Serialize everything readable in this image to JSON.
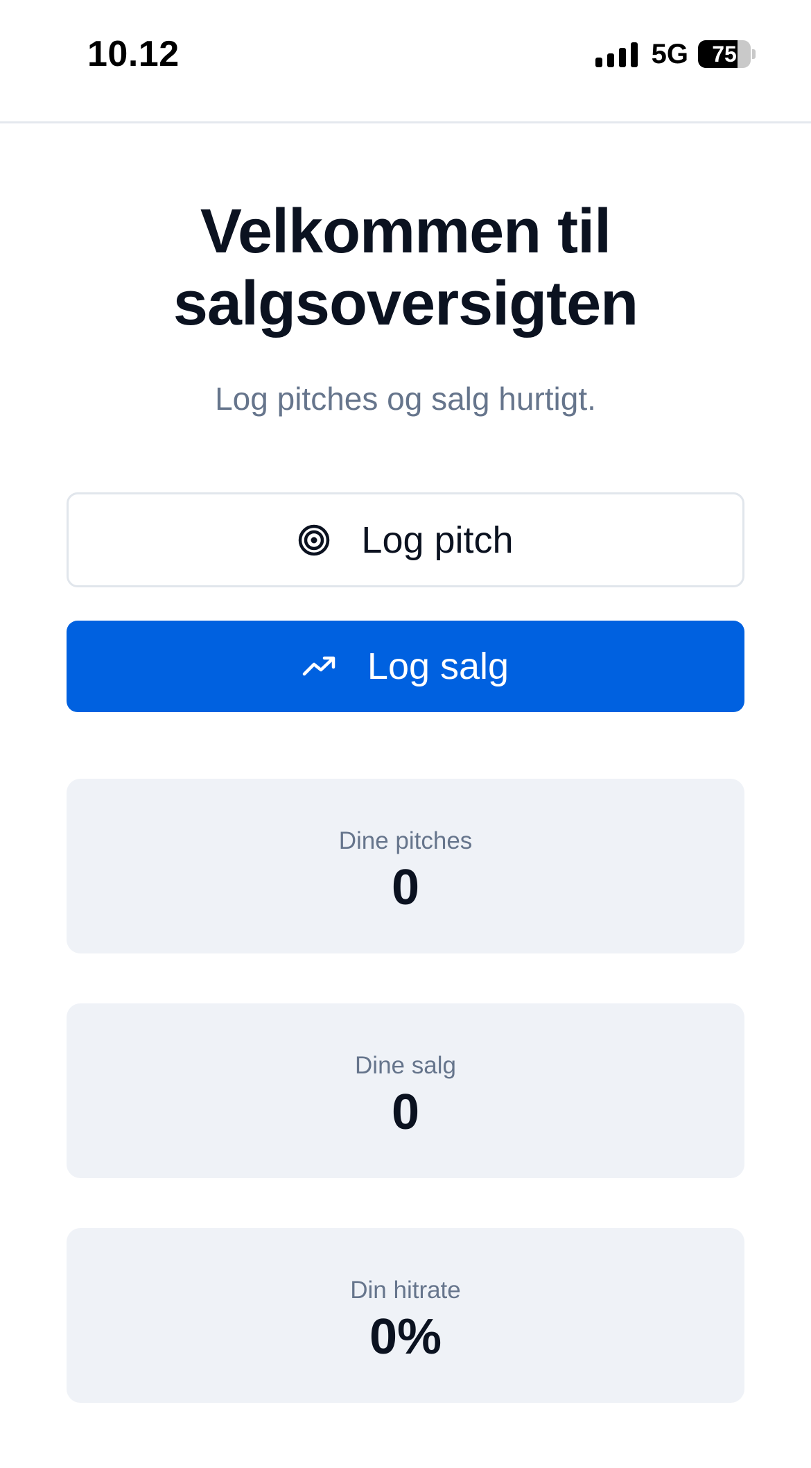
{
  "status_bar": {
    "time": "10.12",
    "network": "5G",
    "battery_level": "75",
    "battery_percent": 75
  },
  "header": {
    "title_line1": "Velkommen til",
    "title_line2": "salgsoversigten",
    "subtitle": "Log pitches og salg hurtigt."
  },
  "actions": {
    "log_pitch": {
      "label": "Log pitch",
      "icon": "target-icon"
    },
    "log_sale": {
      "label": "Log salg",
      "icon": "trending-up-icon"
    }
  },
  "stats": {
    "pitches": {
      "label": "Dine pitches",
      "value": "0"
    },
    "sales": {
      "label": "Dine salg",
      "value": "0"
    },
    "hitrate": {
      "label": "Din hitrate",
      "value": "0%"
    }
  },
  "colors": {
    "primary": "#0061e0",
    "text": "#0b1220",
    "muted": "#66758c",
    "card_bg": "#eff2f7"
  }
}
